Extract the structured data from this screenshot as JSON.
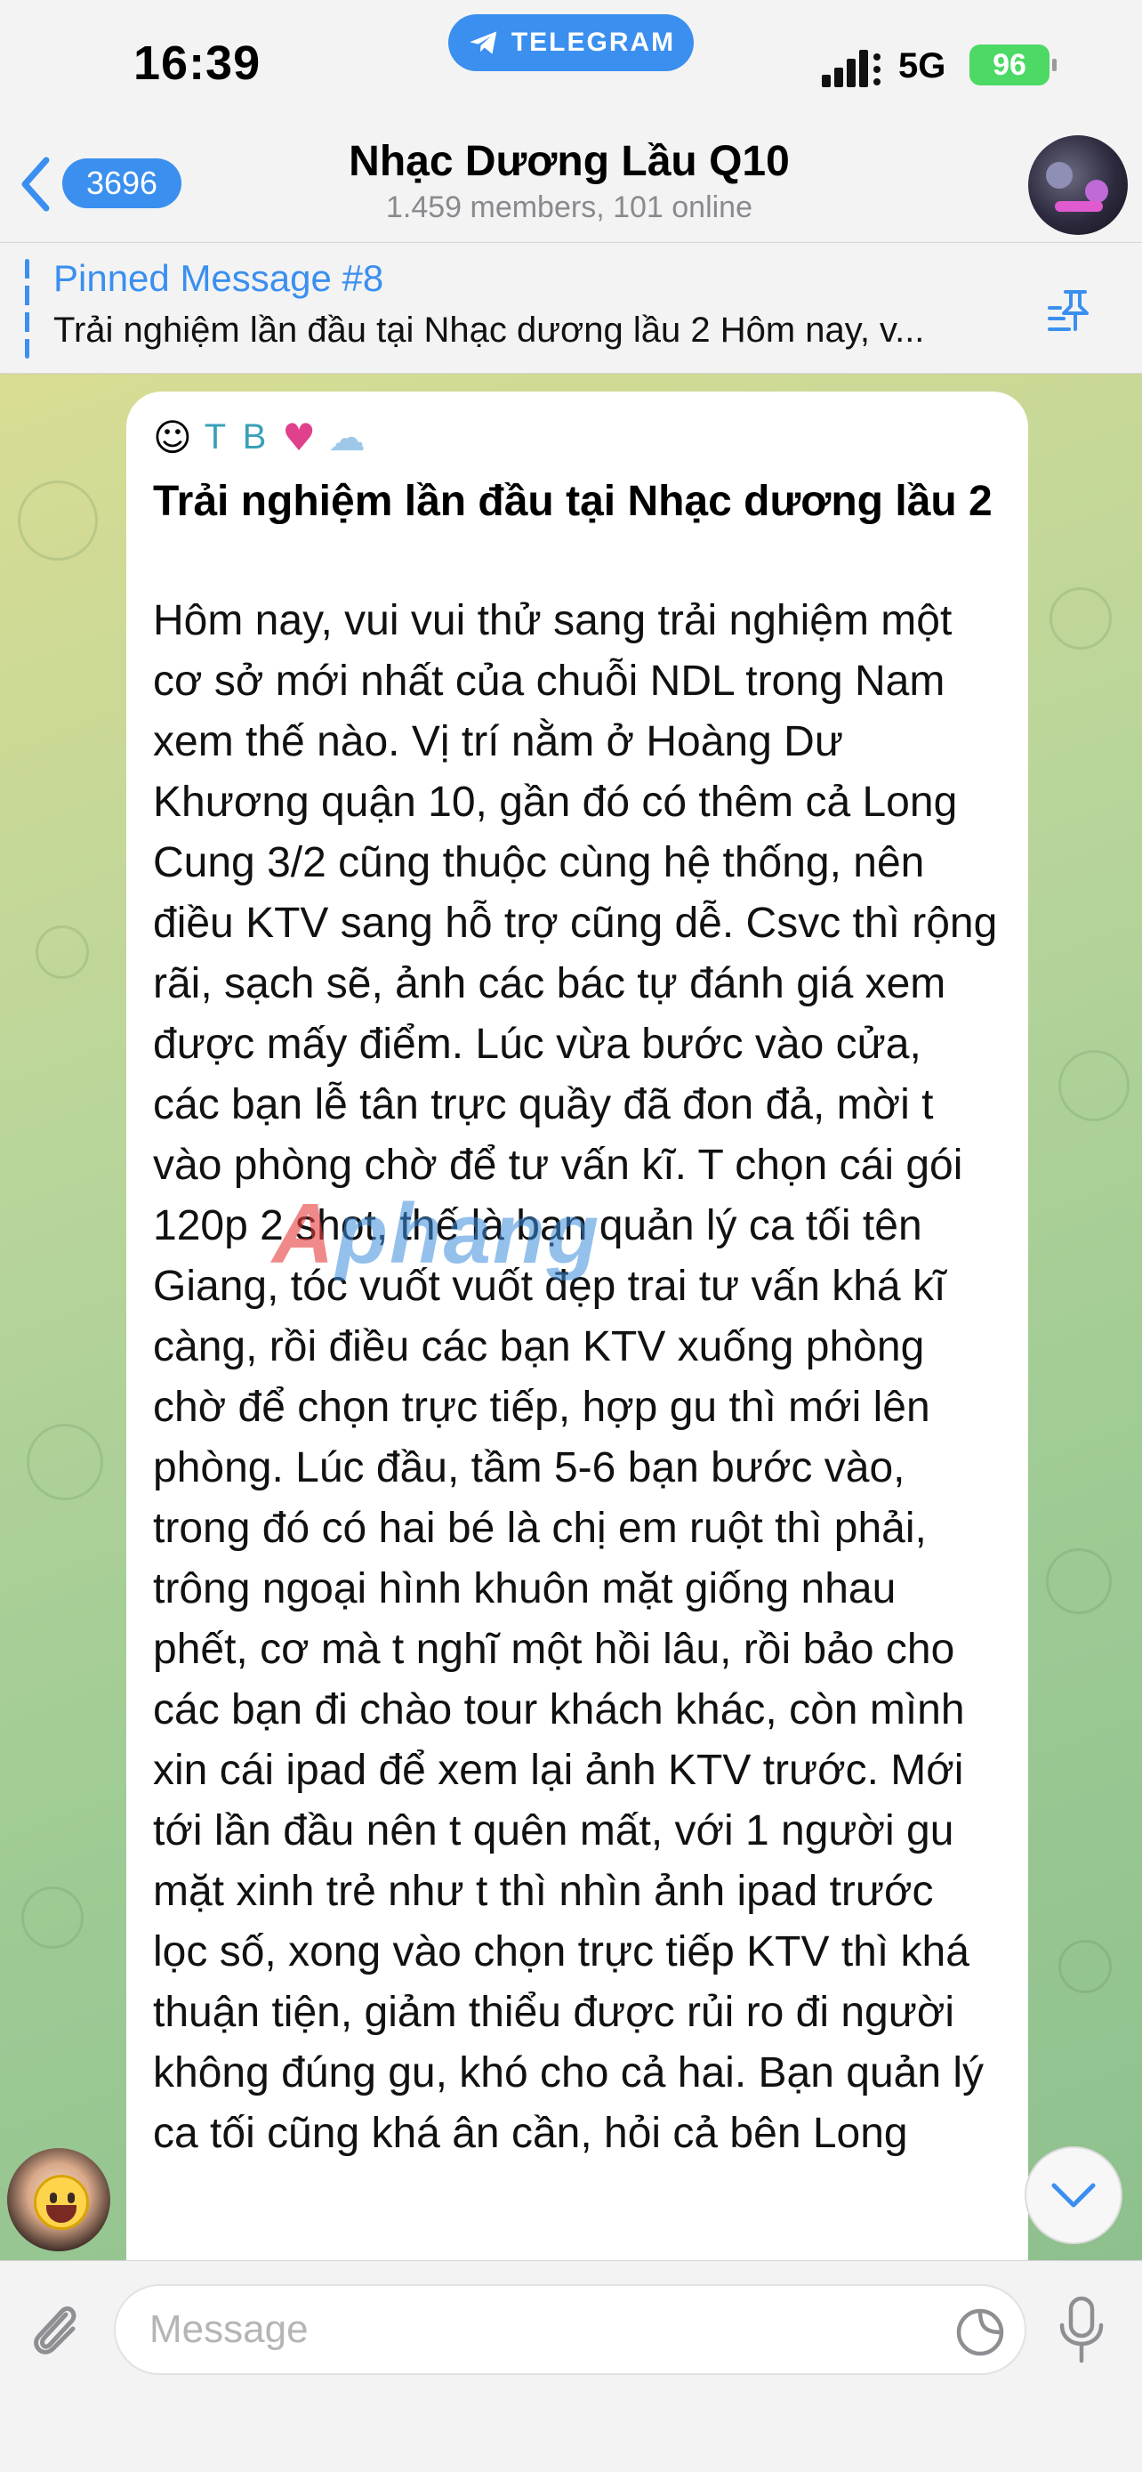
{
  "status_bar": {
    "time": "16:39",
    "pill_label": "TELEGRAM",
    "network": "5G",
    "battery": "96"
  },
  "header": {
    "back_count": "3696",
    "title": "Nhạc Dương Lầu Q10",
    "subtitle": "1.459 members, 101 online"
  },
  "pinned": {
    "title": "Pinned Message #8",
    "text": "Trải nghiệm lần đầu tại Nhạc dương lầu 2 Hôm nay, v..."
  },
  "message": {
    "sender_initials": "T B",
    "title": "Trải nghiệm lần đầu tại Nhạc dương lầu 2",
    "body": "Hôm nay, vui vui thử sang trải nghiệm một cơ sở mới nhất của chuỗi NDL trong Nam xem thế nào. Vị trí nằm ở Hoàng Dư Khương quận 10, gần đó có thêm cả Long Cung 3/2 cũng thuộc cùng hệ thống, nên điều KTV sang hỗ trợ cũng dễ. Csvc thì rộng rãi, sạch sẽ, ảnh các bác tự đánh giá xem được mấy điểm. Lúc vừa bước vào cửa, các bạn lễ tân trực quầy đã đon đả, mời t vào phòng chờ để tư vấn kĩ. T chọn cái gói 120p 2 shot, thế là bạn quản lý ca tối tên Giang, tóc vuốt vuốt đẹp trai tư vấn khá kĩ càng, rồi điều các bạn KTV xuống phòng chờ để chọn trực tiếp, hợp gu thì mới lên phòng. Lúc đầu, tầm 5-6 bạn bước vào, trong đó có hai bé là chị em ruột thì phải, trông ngoại hình khuôn mặt giống nhau phết, cơ mà t nghĩ một hồi lâu, rồi bảo cho các bạn đi chào tour khách khác, còn mình xin cái ipad để xem lại ảnh KTV trước. Mới tới lần đầu nên t quên mất, với 1 người gu mặt xinh trẻ như t thì nhìn ảnh ipad trước lọc số, xong vào chọn trực tiếp KTV thì khá thuận tiện, giảm thiểu được rủi ro đi người không đúng gu, khó cho cả hai. Bạn quản lý ca tối cũng khá ân cần, hỏi cả bên Long",
    "watermark_a": "A",
    "watermark_b": "phang"
  },
  "input": {
    "placeholder": "Message"
  },
  "icons": {
    "pill": "telegram-plane-icon",
    "back": "chevron-left-icon",
    "pin": "pin-list-icon",
    "attach": "paperclip-icon",
    "sticker": "sticker-icon",
    "mic": "microphone-icon",
    "scroll": "chevron-down-icon"
  },
  "colors": {
    "accent": "#3a8fef",
    "battery": "#4cd964",
    "sender_name": "#3aa0b8"
  }
}
